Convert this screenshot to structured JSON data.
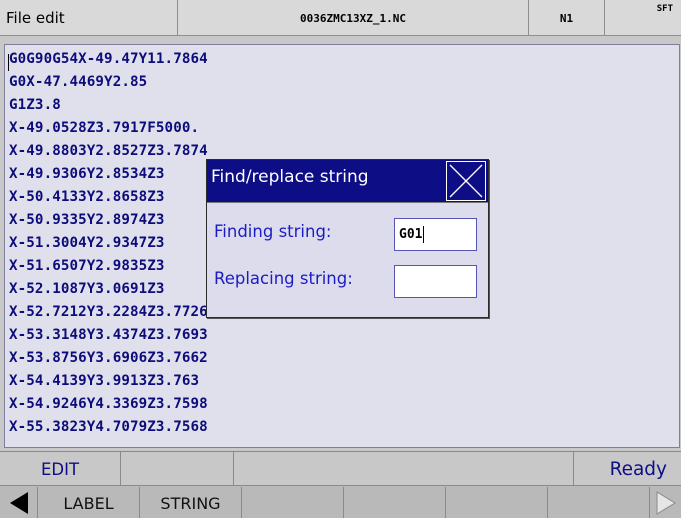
{
  "header": {
    "title": "File edit",
    "filename": "0036ZMC13XZ_1.NC",
    "sequence": "N1",
    "shift": "SFT"
  },
  "editor": {
    "lines": [
      "G0G90G54X-49.47Y11.7864",
      "G0X-47.4469Y2.85",
      "G1Z3.8",
      "X-49.0528Z3.7917F5000.",
      "X-49.8803Y2.8527Z3.7874",
      "X-49.9306Y2.8534Z3",
      "X-50.4133Y2.8658Z3",
      "X-50.9335Y2.8974Z3",
      "X-51.3004Y2.9347Z3",
      "X-51.6507Y2.9835Z3",
      "X-52.1087Y3.0691Z3",
      "X-52.7212Y3.2284Z3.7726",
      "X-53.3148Y3.4374Z3.7693",
      "X-53.8756Y3.6906Z3.7662",
      "X-54.4139Y3.9913Z3.763",
      "X-54.9246Y4.3369Z3.7598",
      "X-55.3823Y4.7079Z3.7568"
    ]
  },
  "dialog": {
    "title": "Find/replace string",
    "find_label": "Finding string:",
    "find_value": "G01",
    "replace_label": "Replacing string:",
    "replace_value": ""
  },
  "status": {
    "mode": "EDIT",
    "state": "Ready"
  },
  "softkeys": {
    "prev_icon": "left-arrow-icon",
    "label": "LABEL",
    "string": "STRING",
    "next_icon": "right-arrow-icon"
  },
  "colors": {
    "dialog_title_bg": "#0d0d86",
    "code_text": "#0c0c7a",
    "label_text": "#1c1cc4",
    "editor_bg": "#e0e0ec"
  }
}
